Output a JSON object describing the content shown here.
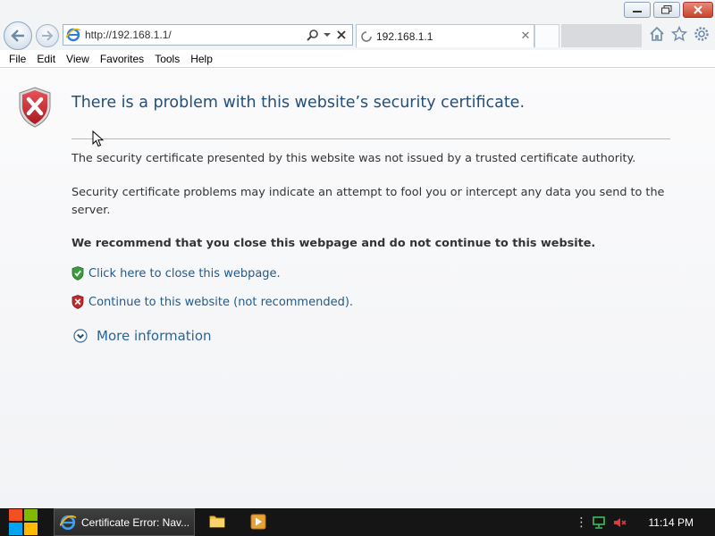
{
  "window": {
    "minimize_icon": "minimize-icon",
    "restore_icon": "restore-icon",
    "close_icon": "close-icon"
  },
  "navbar": {
    "back_icon": "back-arrow-icon",
    "forward_icon": "forward-arrow-icon",
    "address": "http://192.168.1.1/",
    "search_icon": "search-icon",
    "dropdown_icon": "chevron-down-icon",
    "stop_icon": "close-icon",
    "tab_title": "192.168.1.1",
    "tab_close": "✕",
    "toolbar_icons": [
      "home-icon",
      "star-icon",
      "gear-icon"
    ]
  },
  "menu": [
    "File",
    "Edit",
    "View",
    "Favorites",
    "Tools",
    "Help"
  ],
  "page": {
    "heading": "There is a problem with this website’s security certificate.",
    "paragraph1": "The security certificate presented by this website was not issued by a trusted certificate authority.",
    "paragraph2": "Security certificate problems may indicate an attempt to fool you or intercept any data you send to the server.",
    "recommendation": "We recommend that you close this webpage and do not continue to this website.",
    "close_link": "Click here to close this webpage.",
    "continue_link": "Continue to this website (not recommended).",
    "more_info": "More information"
  },
  "taskbar": {
    "task_label": "Certificate Error: Nav...",
    "clock": "11:14 PM"
  },
  "colors": {
    "heading": "#244f7a",
    "link": "#1f5a8f",
    "shield_red": "#c0282d",
    "shield_green": "#3a9c3a",
    "taskbar": "#151515"
  }
}
